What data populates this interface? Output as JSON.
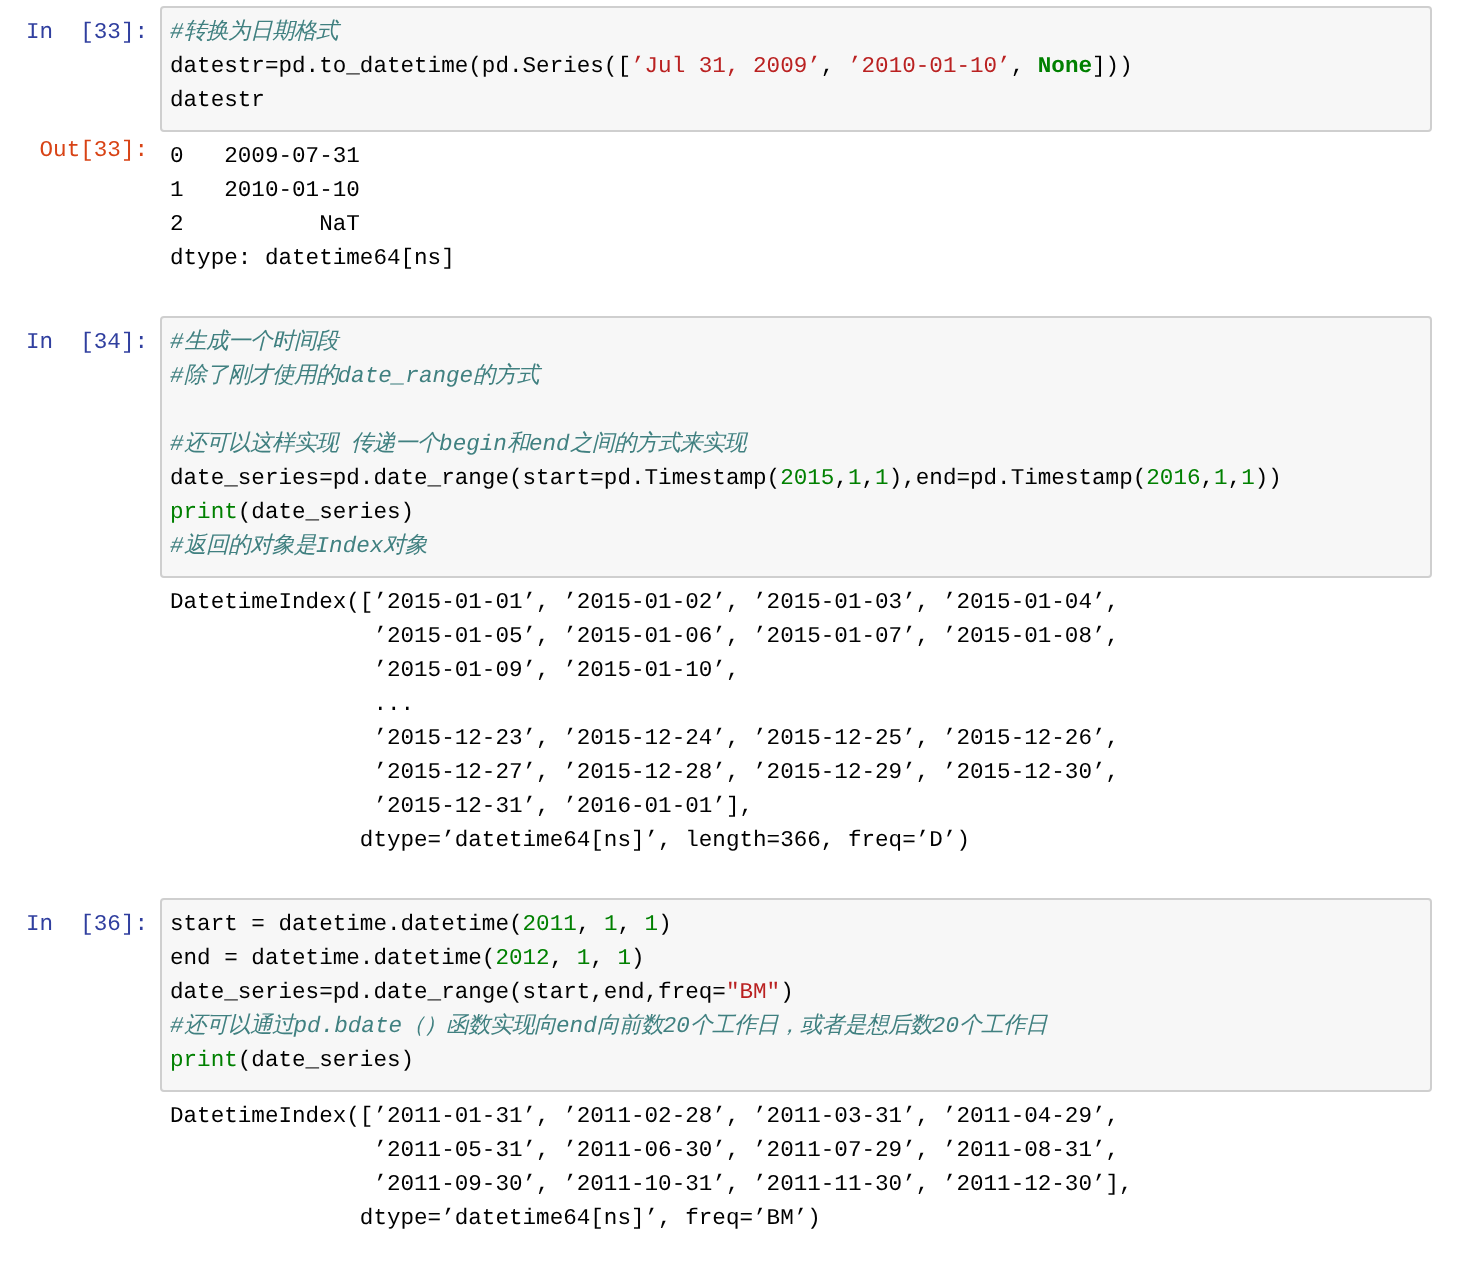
{
  "cells": [
    {
      "prompt": "In  [33]:",
      "code": [
        [
          {
            "kind": "comment",
            "text": "#转换为日期格式"
          }
        ],
        [
          {
            "kind": "plain",
            "text": "datestr=pd.to_datetime(pd.Series(["
          },
          {
            "kind": "string",
            "text": "’Jul 31, 2009’"
          },
          {
            "kind": "plain",
            "text": ", "
          },
          {
            "kind": "string",
            "text": "’2010-01-10’"
          },
          {
            "kind": "plain",
            "text": ", "
          },
          {
            "kind": "keyword",
            "text": "None"
          },
          {
            "kind": "plain",
            "text": "]))"
          }
        ],
        [
          {
            "kind": "plain",
            "text": "datestr"
          }
        ]
      ],
      "out_prompt": "Out[33]:",
      "output": [
        "0   2009-07-31",
        "1   2010-01-10",
        "2          NaT",
        "dtype: datetime64[ns]"
      ]
    },
    {
      "prompt": "In  [34]:",
      "code": [
        [
          {
            "kind": "comment",
            "text": "#生成一个时间段"
          }
        ],
        [
          {
            "kind": "comment",
            "text": "#除了刚才使用的date_range的方式"
          }
        ],
        {
          "kind": "blank"
        },
        [
          {
            "kind": "comment",
            "text": "#还可以这样实现 传递一个begin和end之间的方式来实现"
          }
        ],
        [
          {
            "kind": "plain",
            "text": "date_series=pd.date_range(start=pd.Timestamp("
          },
          {
            "kind": "number",
            "text": "2015"
          },
          {
            "kind": "plain",
            "text": ","
          },
          {
            "kind": "number",
            "text": "1"
          },
          {
            "kind": "plain",
            "text": ","
          },
          {
            "kind": "number",
            "text": "1"
          },
          {
            "kind": "plain",
            "text": "),end=pd.Timestamp("
          },
          {
            "kind": "number",
            "text": "2016"
          },
          {
            "kind": "plain",
            "text": ","
          },
          {
            "kind": "number",
            "text": "1"
          },
          {
            "kind": "plain",
            "text": ","
          },
          {
            "kind": "number",
            "text": "1"
          },
          {
            "kind": "plain",
            "text": "))"
          }
        ],
        [
          {
            "kind": "builtin",
            "text": "print"
          },
          {
            "kind": "plain",
            "text": "(date_series)"
          }
        ],
        [
          {
            "kind": "comment",
            "text": "#返回的对象是Index对象"
          }
        ]
      ],
      "output": [
        "DatetimeIndex([’2015-01-01’, ’2015-01-02’, ’2015-01-03’, ’2015-01-04’,",
        "               ’2015-01-05’, ’2015-01-06’, ’2015-01-07’, ’2015-01-08’,",
        "               ’2015-01-09’, ’2015-01-10’,",
        "               ...",
        "               ’2015-12-23’, ’2015-12-24’, ’2015-12-25’, ’2015-12-26’,",
        "               ’2015-12-27’, ’2015-12-28’, ’2015-12-29’, ’2015-12-30’,",
        "               ’2015-12-31’, ’2016-01-01’],",
        "              dtype=’datetime64[ns]’, length=366, freq=’D’)"
      ]
    },
    {
      "prompt": "In  [36]:",
      "code": [
        [
          {
            "kind": "plain",
            "text": "start = datetime.datetime("
          },
          {
            "kind": "number",
            "text": "2011"
          },
          {
            "kind": "plain",
            "text": ", "
          },
          {
            "kind": "number",
            "text": "1"
          },
          {
            "kind": "plain",
            "text": ", "
          },
          {
            "kind": "number",
            "text": "1"
          },
          {
            "kind": "plain",
            "text": ")"
          }
        ],
        [
          {
            "kind": "plain",
            "text": "end = datetime.datetime("
          },
          {
            "kind": "number",
            "text": "2012"
          },
          {
            "kind": "plain",
            "text": ", "
          },
          {
            "kind": "number",
            "text": "1"
          },
          {
            "kind": "plain",
            "text": ", "
          },
          {
            "kind": "number",
            "text": "1"
          },
          {
            "kind": "plain",
            "text": ")"
          }
        ],
        [
          {
            "kind": "plain",
            "text": "date_series=pd.date_range(start,end,freq="
          },
          {
            "kind": "string",
            "text": "\"BM\""
          },
          {
            "kind": "plain",
            "text": ")"
          }
        ],
        [
          {
            "kind": "comment",
            "text": "#还可以通过pd.bdate（）函数实现向end向前数20个工作日，或者是想后数20个工作日"
          }
        ],
        [
          {
            "kind": "builtin",
            "text": "print"
          },
          {
            "kind": "plain",
            "text": "(date_series)"
          }
        ]
      ],
      "output": [
        "DatetimeIndex([’2011-01-31’, ’2011-02-28’, ’2011-03-31’, ’2011-04-29’,",
        "               ’2011-05-31’, ’2011-06-30’, ’2011-07-29’, ’2011-08-31’,",
        "               ’2011-09-30’, ’2011-10-31’, ’2011-11-30’, ’2011-12-30’],",
        "              dtype=’datetime64[ns]’, freq=’BM’)"
      ]
    }
  ]
}
